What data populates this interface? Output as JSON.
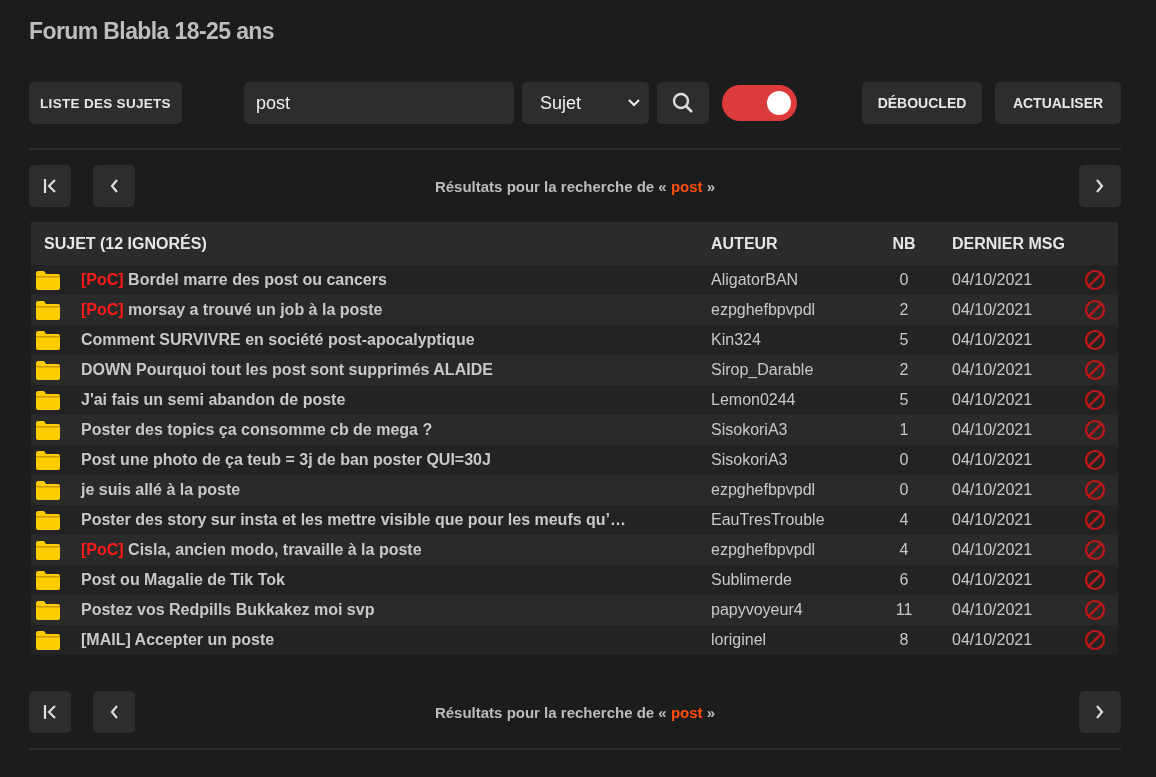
{
  "title": "Forum Blabla 18-25 ans",
  "toolbar": {
    "topics_button": "LISTE DES SUJETS",
    "search": {
      "value": "post"
    },
    "search_type": {
      "value": "Sujet"
    },
    "toggle": {
      "on": true
    },
    "buttons": [
      "DÉBOUCLED",
      "ACTUALISER"
    ]
  },
  "pager_top": {
    "prefix": "Résultats pour la recherche de «",
    "term": "post",
    "suffix": "»"
  },
  "table": {
    "columns": [
      "SUJET (12 IGNORÉS)",
      "AUTEUR",
      "NB",
      "DERNIER MSG"
    ],
    "rows": [
      {
        "tag": "[PoC]",
        "subject": "Bordel marre des post ou cancers",
        "author": "AligatorBAN",
        "nb": "0",
        "date": "04/10/2021"
      },
      {
        "tag": "[PoC]",
        "subject": "morsay a trouvé un job à la poste",
        "author": "ezpghefbpvpdl",
        "nb": "2",
        "date": "04/10/2021"
      },
      {
        "subject": "Comment SURVIVRE en société post-apocalyptique",
        "author": "Kin324",
        "nb": "5",
        "date": "04/10/2021"
      },
      {
        "subject": "DOWN Pourquoi tout les post sont supprimés ALAIDE",
        "author": "Sirop_Darable",
        "nb": "2",
        "date": "04/10/2021"
      },
      {
        "subject": "J'ai fais un semi abandon de poste",
        "author": "Lemon0244",
        "nb": "5",
        "date": "04/10/2021"
      },
      {
        "subject": "Poster des topics ça consomme cb de mega ?",
        "author": "SisokoriA3",
        "nb": "1",
        "date": "04/10/2021"
      },
      {
        "subject": "Post une photo de ça teub = 3j de ban poster QUI=30J",
        "author": "SisokoriA3",
        "nb": "0",
        "date": "04/10/2021"
      },
      {
        "subject": "je suis allé à la poste",
        "author": "ezpghefbpvpdl",
        "nb": "0",
        "date": "04/10/2021"
      },
      {
        "subject": "Poster des story sur insta et les mettre visible que pour les meufs qu’…",
        "author": "EauTresTrouble",
        "nb": "4",
        "date": "04/10/2021"
      },
      {
        "tag": "[PoC]",
        "subject": "Cisla, ancien modo, travaille à la poste",
        "author": "ezpghefbpvpdl",
        "nb": "4",
        "date": "04/10/2021"
      },
      {
        "subject": "Post ou Magalie de Tik Tok",
        "author": "Sublimerde",
        "nb": "6",
        "date": "04/10/2021"
      },
      {
        "subject": "Postez vos Redpills Bukkakez moi svp",
        "author": "papyvoyeur4",
        "nb": "11",
        "date": "04/10/2021"
      },
      {
        "subject": "[MAIL] Accepter un poste",
        "author": "loriginel",
        "nb": "8",
        "date": "04/10/2021"
      }
    ]
  },
  "pager_bottom": {
    "prefix": "Résultats pour la recherche de «",
    "term": "post",
    "suffix": "»"
  }
}
